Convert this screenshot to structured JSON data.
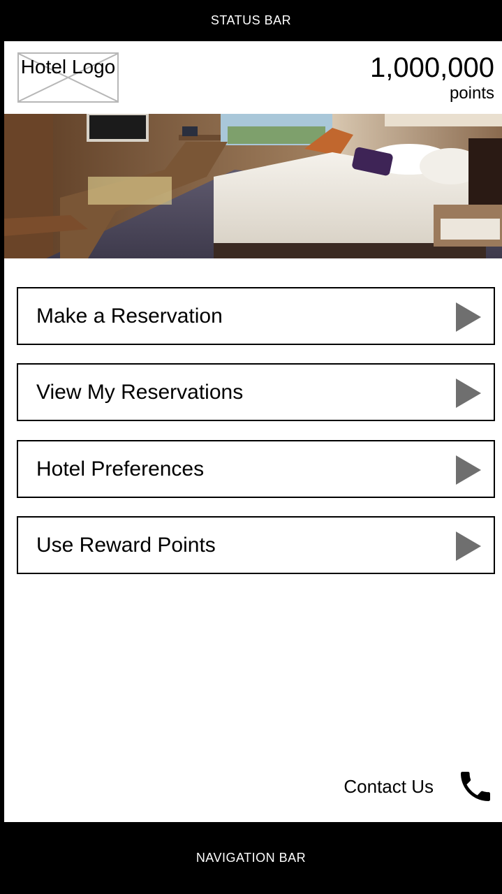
{
  "status_bar": {
    "label": "STATUS BAR"
  },
  "header": {
    "logo_text": "Hotel Logo",
    "points_value": "1,000,000",
    "points_label": "points"
  },
  "menu": [
    {
      "label": "Make a Reservation",
      "icon": "play-arrow-icon"
    },
    {
      "label": "View My Reservations",
      "icon": "play-arrow-icon"
    },
    {
      "label": "Hotel Preferences",
      "icon": "play-arrow-icon"
    },
    {
      "label": "Use Reward Points",
      "icon": "play-arrow-icon"
    }
  ],
  "contact": {
    "label": "Contact Us",
    "icon": "phone-icon"
  },
  "nav_bar": {
    "label": "NAVIGATION BAR"
  },
  "colors": {
    "bars": "#000000",
    "arrow": "#6f6f6f",
    "logo_border": "#b7b7b7"
  }
}
